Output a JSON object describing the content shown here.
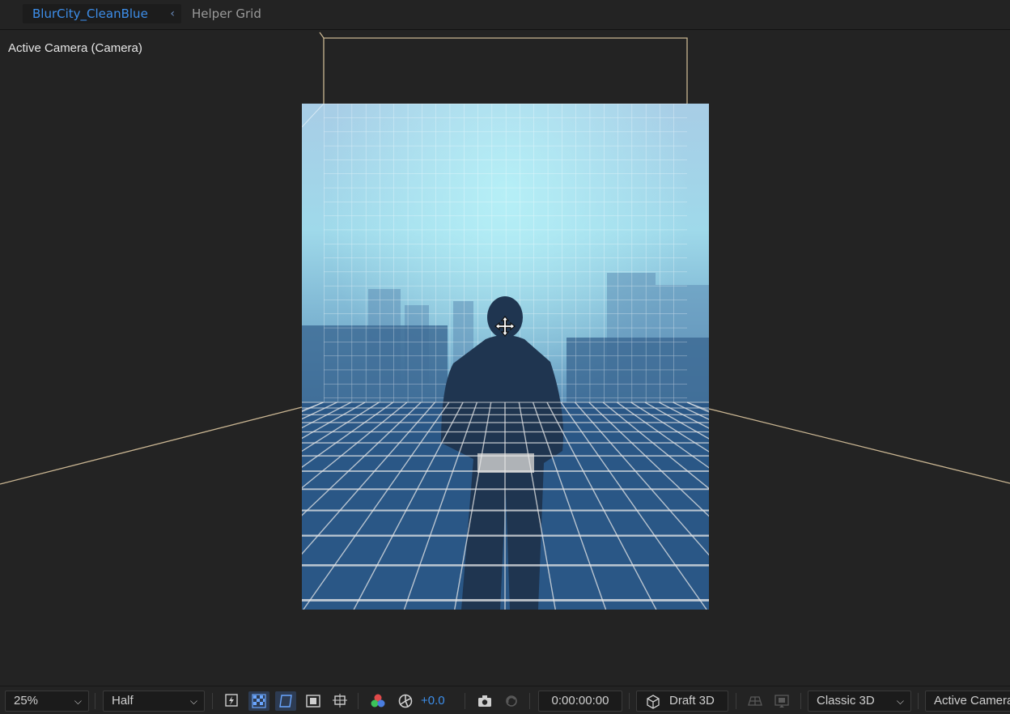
{
  "tabs": {
    "active": "BlurCity_CleanBlue",
    "inactive": "Helper Grid",
    "chevron": "‹"
  },
  "viewer": {
    "camera_label": "Active Camera (Camera)"
  },
  "toolbar": {
    "zoom": "25%",
    "resolution": "Half",
    "exposure": "+0.0",
    "timecode": "0:00:00:00",
    "draft3d": "Draft 3D",
    "renderer": "Classic 3D",
    "view": "Active Camera",
    "dropdown_glyph": "⌵"
  },
  "icons": {
    "fast_preview": "fast-preview-icon",
    "transparency_grid": "transparency-grid-icon",
    "mask_path": "mask-visibility-icon",
    "region_of_interest": "region-of-interest-icon",
    "grid_guides": "grid-guides-icon",
    "channels": "rgb-channels-icon",
    "reset_exposure": "reset-exposure-icon",
    "snapshot": "camera-snapshot-icon",
    "show_snapshot": "show-snapshot-icon",
    "draft3d": "draft-3d-cube-icon",
    "extended_viewer": "ground-plane-icon",
    "extended_viewer2": "extended-viewer-icon",
    "move_cursor": "move-cursor-icon"
  },
  "colors": {
    "accent": "#3d8eea",
    "comp_frame": "#c9b592",
    "panel_bg": "#232323"
  }
}
